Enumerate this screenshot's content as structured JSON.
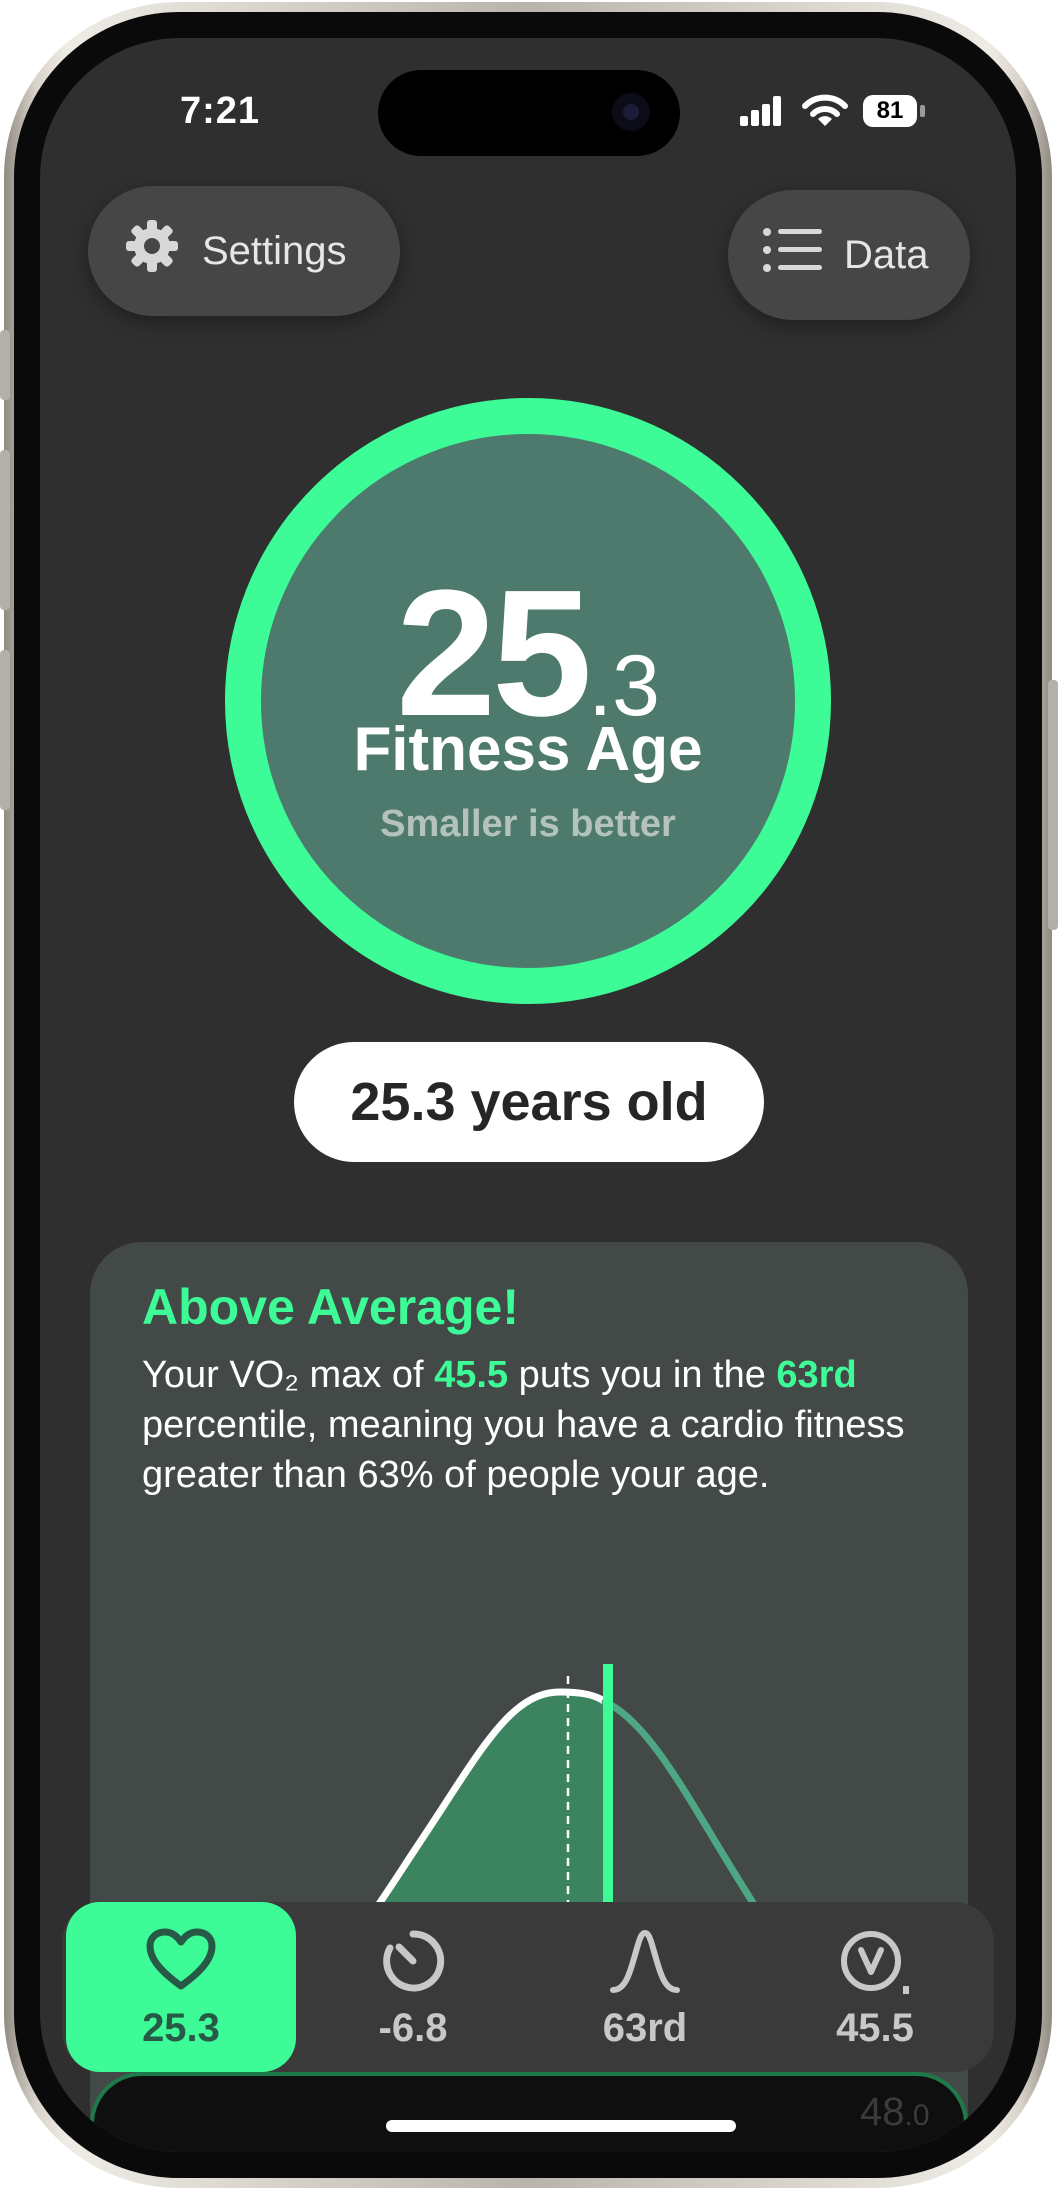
{
  "status_bar": {
    "time": "7:21",
    "battery": "81"
  },
  "header": {
    "settings_label": "Settings",
    "data_label": "Data"
  },
  "fitness_age": {
    "value_int": "25",
    "value_dec": ".3",
    "label": "Fitness Age",
    "subtitle": "Smaller is better",
    "years_text": "25.3 years old"
  },
  "summary_card": {
    "title": "Above Average!",
    "text_1": "Your VO₂ max of ",
    "vo2_value": "45.5",
    "text_2": " puts you in the ",
    "percentile": "63rd",
    "text_3": " percentile, meaning you have a cardio fitness greater than 63% of people your age."
  },
  "tabs": [
    {
      "icon": "heart-icon",
      "value": "25.3",
      "active": true
    },
    {
      "icon": "timer-icon",
      "value": "-6.8",
      "active": false
    },
    {
      "icon": "bell-curve-icon",
      "value": "63rd",
      "active": false
    },
    {
      "icon": "vo2-icon",
      "value": "45.5",
      "active": false
    }
  ],
  "peek": {
    "value_int": "48",
    "value_dec": ".0"
  },
  "colors": {
    "accent": "#3dfb96",
    "background": "#2f2f2f",
    "card": "#424947",
    "ring_fill": "#4d7a6d"
  }
}
